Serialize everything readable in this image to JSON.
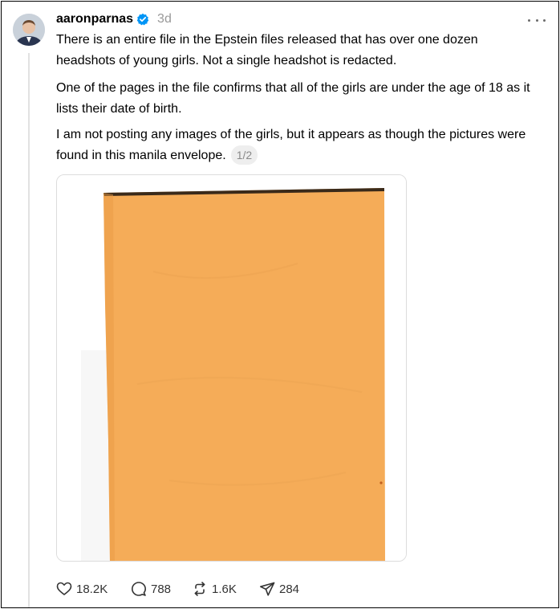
{
  "post": {
    "username": "aaronparnas",
    "time": "3d",
    "paragraphs": [
      "There is an entire file in the Epstein files released that has over one dozen headshots of young girls. Not a single headshot is redacted.",
      "One of the pages in the file confirms that all of the girls are under the age of 18 as it lists their date of birth.",
      "I am not posting any images of the girls, but it appears as though the pictures were found in this manila envelope."
    ],
    "page_indicator": "1/2",
    "media_subject": "manila-envelope-photo",
    "colors": {
      "envelope": "#f5ac58",
      "verified_badge": "#0095f6",
      "timestamp": "#999999",
      "thread_line": "#e2e2e2"
    }
  },
  "actions": {
    "likes": "18.2K",
    "replies": "788",
    "reposts": "1.6K",
    "shares": "284"
  },
  "icons": {
    "more": "more-dots-icon",
    "like": "heart-icon",
    "reply": "comment-icon",
    "repost": "repost-icon",
    "share": "send-icon",
    "verified": "verified-badge-icon"
  }
}
